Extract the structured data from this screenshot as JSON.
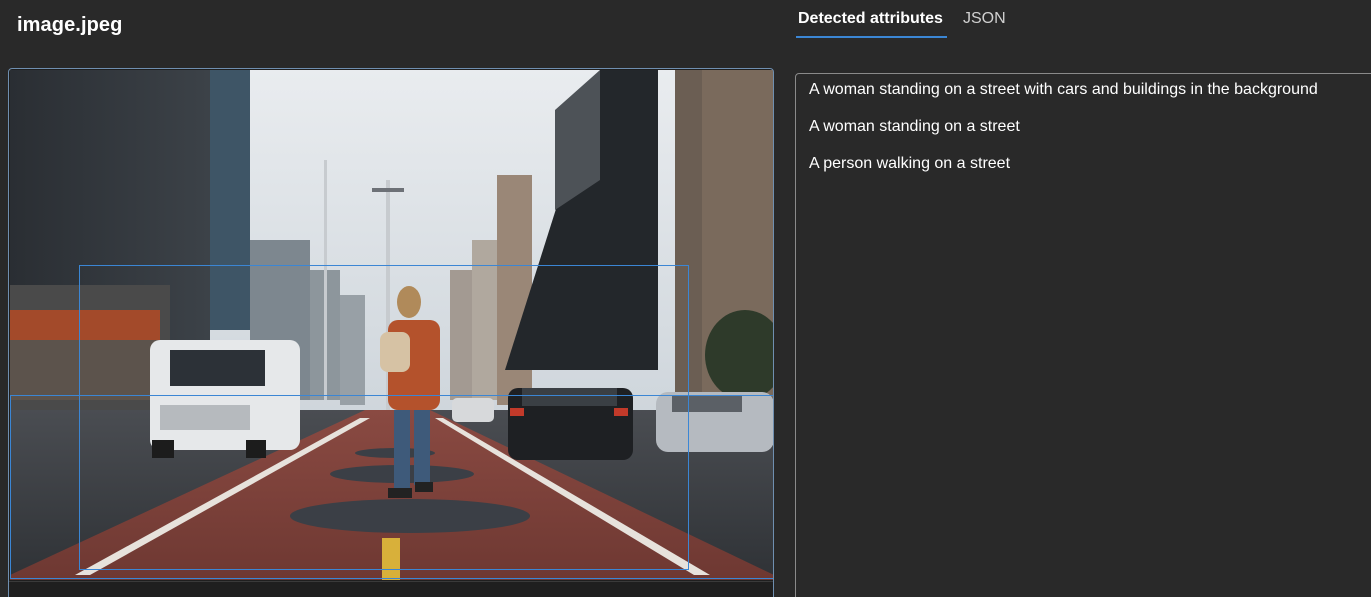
{
  "header": {
    "file_name": "image.jpeg"
  },
  "tabs": [
    {
      "label": "Detected attributes",
      "active": true
    },
    {
      "label": "JSON",
      "active": false
    }
  ],
  "attributes": [
    "A woman standing on a street with cars and buildings in the background",
    "A woman standing on a street",
    "A person walking on a street"
  ],
  "colors": {
    "background": "#292929",
    "accent": "#3b86d4",
    "panel_border": "#8a8a8a"
  }
}
